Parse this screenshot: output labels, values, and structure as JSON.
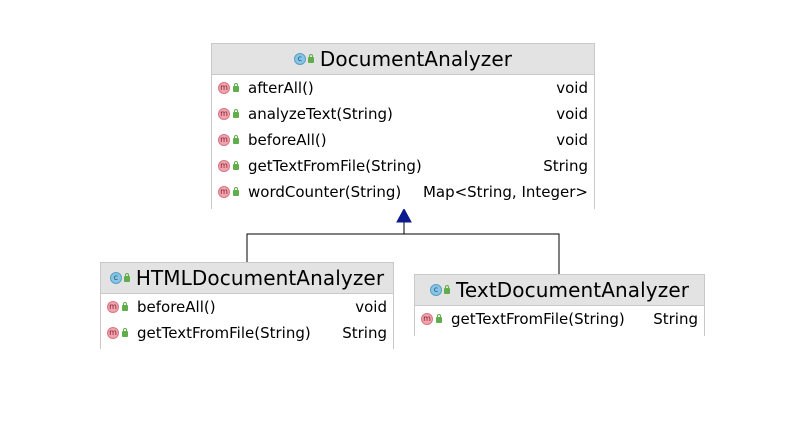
{
  "diagram": {
    "classes": [
      {
        "id": "document-analyzer",
        "name": "DocumentAnalyzer",
        "methods": [
          {
            "name": "afterAll()",
            "returns": "void"
          },
          {
            "name": "analyzeText(String)",
            "returns": "void"
          },
          {
            "name": "beforeAll()",
            "returns": "void"
          },
          {
            "name": "getTextFromFile(String)",
            "returns": "String"
          },
          {
            "name": "wordCounter(String)",
            "returns": "Map<String, Integer>"
          }
        ]
      },
      {
        "id": "html-document-analyzer",
        "name": "HTMLDocumentAnalyzer",
        "methods": [
          {
            "name": "beforeAll()",
            "returns": "void"
          },
          {
            "name": "getTextFromFile(String)",
            "returns": "String"
          }
        ]
      },
      {
        "id": "text-document-analyzer",
        "name": "TextDocumentAnalyzer",
        "methods": [
          {
            "name": "getTextFromFile(String)",
            "returns": "String"
          }
        ]
      }
    ],
    "icons": {
      "class_badge": "class-icon",
      "method_badge": "method-icon",
      "visibility": "public-lock-icon",
      "class_badge_letter": "c",
      "method_badge_letter": "m"
    },
    "relations": [
      {
        "type": "inheritance",
        "from": "HTMLDocumentAnalyzer",
        "to": "DocumentAnalyzer"
      },
      {
        "type": "inheritance",
        "from": "TextDocumentAnalyzer",
        "to": "DocumentAnalyzer"
      }
    ],
    "colors": {
      "header_bg": "#e3e3e3",
      "border": "#c9c9c9",
      "edge": "#000000",
      "arrow_head": "#0b1a8c",
      "class_badge": "#87c5e6",
      "method_badge": "#f2a3ae",
      "visibility_lock": "#5fae4b"
    }
  }
}
